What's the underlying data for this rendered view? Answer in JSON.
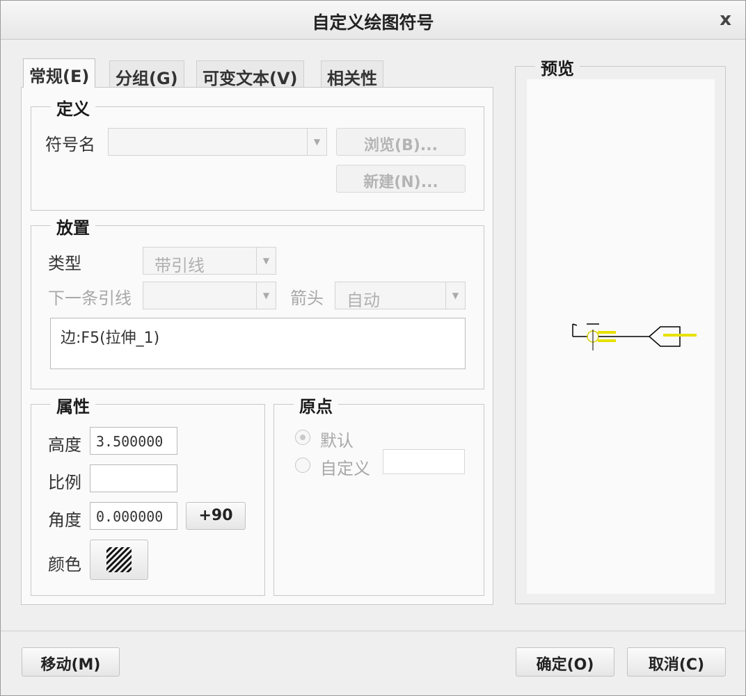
{
  "dialog": {
    "title": "自定义绘图符号",
    "close_label": "x"
  },
  "tabs": [
    {
      "label": "常规(E)",
      "active": true
    },
    {
      "label": "分组(G)",
      "active": false
    },
    {
      "label": "可变文本(V)",
      "active": false
    },
    {
      "label": "相关性",
      "active": false
    }
  ],
  "definition": {
    "legend": "定义",
    "symbol_name_label": "符号名",
    "symbol_name_value": "",
    "browse_label": "浏览(B)...",
    "new_label": "新建(N)..."
  },
  "placement": {
    "legend": "放置",
    "type_label": "类型",
    "type_value": "带引线",
    "next_leader_label": "下一条引线",
    "next_leader_value": "",
    "arrow_label": "箭头",
    "arrow_value": "自动",
    "reference_text": "边:F5(拉伸_1)"
  },
  "attributes": {
    "legend": "属性",
    "height_label": "高度",
    "height_value": "3.500000",
    "scale_label": "比例",
    "scale_value": "",
    "angle_label": "角度",
    "angle_value": "0.000000",
    "rotate_label": "+90",
    "color_label": "颜色"
  },
  "origin": {
    "legend": "原点",
    "default_label": "默认",
    "custom_label": "自定义",
    "custom_value": "",
    "selected": "default"
  },
  "preview": {
    "legend": "预览",
    "symbol_color": "#e8e000",
    "line_color": "#000000"
  },
  "footer": {
    "move_label": "移动(M)",
    "ok_label": "确定(O)",
    "cancel_label": "取消(C)"
  }
}
